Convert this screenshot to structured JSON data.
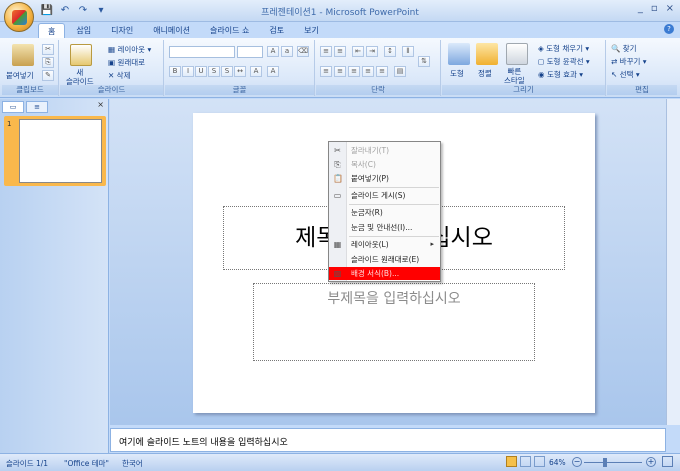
{
  "window": {
    "title": "프레젠테이션1 - Microsoft PowerPoint",
    "controls": [
      "_",
      "▫",
      "×"
    ]
  },
  "quick_access": {
    "save": "💾",
    "undo": "↶",
    "redo": "↷",
    "more": "▾"
  },
  "tabs": [
    "홈",
    "삽입",
    "디자인",
    "애니메이션",
    "슬라이드 쇼",
    "검토",
    "보기"
  ],
  "active_tab": "홈",
  "ribbon": {
    "clipboard": {
      "label": "클립보드",
      "paste": "붙여넣기"
    },
    "slides": {
      "label": "슬라이드",
      "new_slide": "새\n슬라이드",
      "layout": "레이아웃 ▾",
      "reset": "원래대로",
      "delete": "삭제"
    },
    "font": {
      "label": "글꼴"
    },
    "paragraph": {
      "label": "단락"
    },
    "drawing": {
      "label": "그리기",
      "shape": "도형",
      "arrange": "정렬",
      "quick_style": "빠른\n스타일",
      "fill": "도형 채우기 ▾",
      "outline": "도형 윤곽선 ▾",
      "effect": "도형 효과 ▾"
    },
    "editing": {
      "label": "편집",
      "find": "찾기",
      "replace": "바꾸기 ▾",
      "select": "선택 ▾"
    }
  },
  "pane": {
    "close": "×",
    "slide_number": "1"
  },
  "slide": {
    "title_placeholder": "제목을 입력하십시오",
    "subtitle_placeholder": "부제목을 입력하십시오"
  },
  "notes_placeholder": "여기에 슬라이드 노트의 내용을 입력하십시오",
  "status": {
    "slide": "슬라이드 1/1",
    "theme": "\"Office 테마\"",
    "language": "한국어",
    "zoom": "64%"
  },
  "context_menu": [
    {
      "label": "잘라내기(T)",
      "icon": "✂",
      "disabled": true
    },
    {
      "label": "복사(C)",
      "icon": "⎘",
      "disabled": true
    },
    {
      "label": "붙여넣기(P)",
      "icon": "📋",
      "disabled": false
    },
    {
      "label": "슬라이드 게시(S)",
      "icon": "▭",
      "disabled": false
    },
    {
      "label": "눈금자(R)",
      "icon": "",
      "disabled": false
    },
    {
      "label": "눈금 및 안내선(I)...",
      "icon": "",
      "disabled": false
    },
    {
      "label": "레이아웃(L)",
      "icon": "▦",
      "disabled": false,
      "submenu": true
    },
    {
      "label": "슬라이드 원래대로(E)",
      "icon": "",
      "disabled": false
    },
    {
      "label": "배경 서식(B)...",
      "icon": "▨",
      "disabled": false,
      "highlighted": true
    }
  ]
}
